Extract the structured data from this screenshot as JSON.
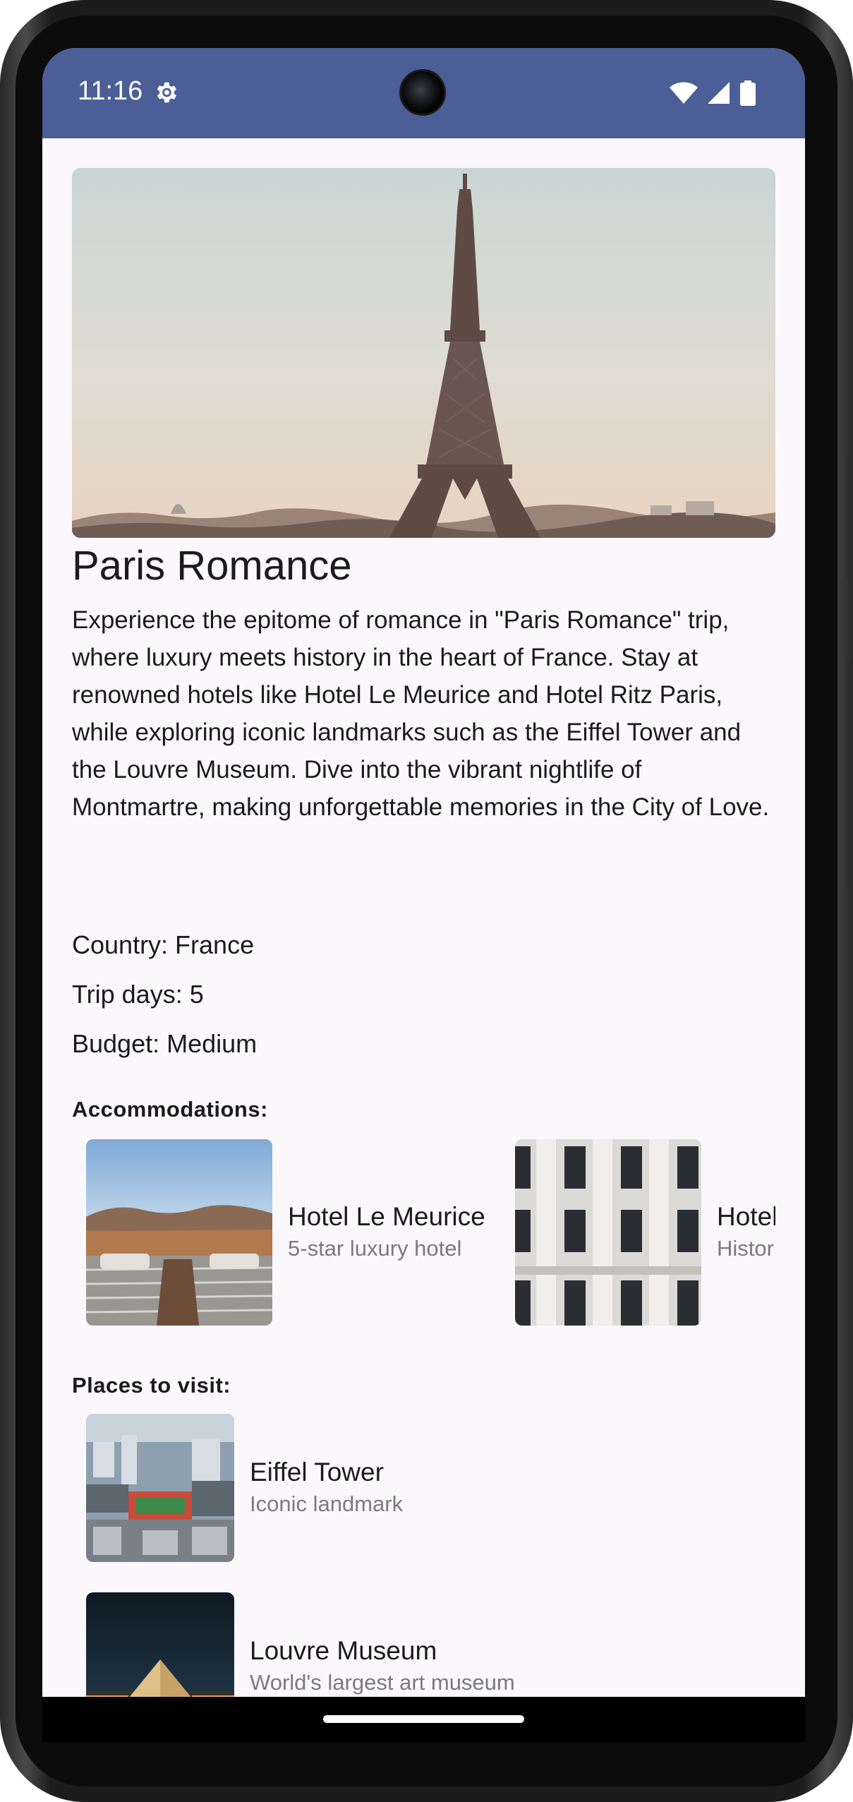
{
  "status_bar": {
    "time": "11:16",
    "icons": [
      "settings-icon",
      "wifi-icon",
      "cellular-signal-icon",
      "battery-icon"
    ],
    "background_color": "#4b5e96"
  },
  "trip": {
    "title": "Paris Romance",
    "description": "Experience the epitome of romance in \"Paris Romance\" trip, where luxury meets history in the heart of France. Stay at renowned hotels like Hotel Le Meurice and Hotel Ritz Paris, while exploring iconic landmarks such as the Eiffel Tower and the Louvre Museum. Dive into the vibrant nightlife of Montmartre, making unforgettable memories in the City of Love.",
    "country": "Country: France",
    "trip_days": "Trip days: 5",
    "budget": "Budget: Medium"
  },
  "accommodations": {
    "heading": "Accommodations:",
    "items": [
      {
        "name": "Hotel Le Meurice",
        "subtitle": "5-star luxury hotel"
      },
      {
        "name": "Hotel Ritz Paris",
        "subtitle": "Historic luxury hotel"
      }
    ]
  },
  "places": {
    "heading": "Places to visit:",
    "items": [
      {
        "name": "Eiffel Tower",
        "subtitle": "Iconic landmark"
      },
      {
        "name": "Louvre Museum",
        "subtitle": "World's largest art museum"
      }
    ]
  }
}
